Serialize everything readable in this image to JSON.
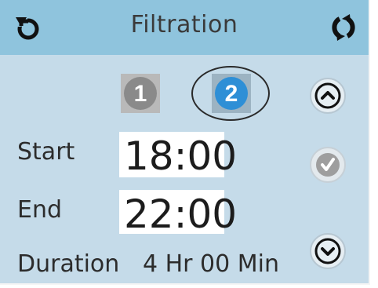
{
  "header": {
    "title": "Filtration",
    "left_icon": "back-icon",
    "right_icon": "refresh-icon"
  },
  "filter_tabs": [
    {
      "label": "1",
      "selected": false
    },
    {
      "label": "2",
      "selected": true
    }
  ],
  "start": {
    "label": "Start",
    "value": "18:00"
  },
  "end": {
    "label": "End",
    "value": "22:00"
  },
  "duration": {
    "label": "Duration",
    "value": "4 Hr 00 Min"
  },
  "controls": {
    "up_icon": "chevron-up-icon",
    "confirm_icon": "checkmark-icon",
    "down_icon": "chevron-down-icon"
  },
  "colors": {
    "background": "#c5dbe9",
    "header": "#8fc4dd",
    "selected_tab": "#2e8fd6",
    "unselected_tab": "#8a8a8a"
  }
}
